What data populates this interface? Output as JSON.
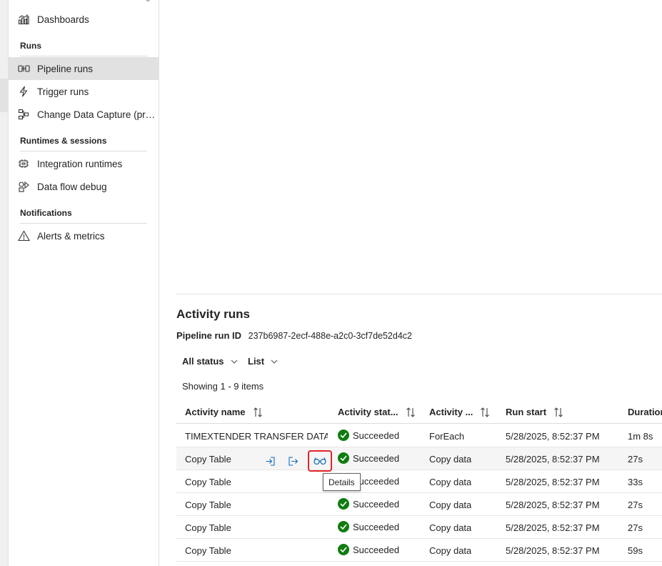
{
  "sidebar": {
    "top_item": {
      "label": "Dashboards",
      "icon": "dashboard-icon"
    },
    "sections": [
      {
        "title": "Runs"
      },
      {
        "title": "Runtimes & sessions"
      },
      {
        "title": "Notifications"
      }
    ],
    "items": [
      {
        "label": "Pipeline runs",
        "icon": "pipeline-icon",
        "selected": true
      },
      {
        "label": "Trigger runs",
        "icon": "lightning-icon"
      },
      {
        "label": "Change Data Capture (previ...",
        "icon": "cdc-icon"
      },
      {
        "label": "Integration runtimes",
        "icon": "runtime-icon"
      },
      {
        "label": "Data flow debug",
        "icon": "dataflow-debug-icon"
      },
      {
        "label": "Alerts & metrics",
        "icon": "alert-icon"
      }
    ]
  },
  "activity": {
    "title": "Activity runs",
    "pipeline_run_id_label": "Pipeline run ID",
    "pipeline_run_id": "237b6987-2ecf-488e-a2c0-3cf7de52d4c2",
    "filter_status": "All status",
    "filter_view": "List",
    "showing": "Showing 1 - 9 items",
    "columns": [
      "Activity name",
      "Activity stat...",
      "Activity ...",
      "Run start",
      "Duration"
    ],
    "rows": [
      {
        "name": "TIMEXTENDER TRANSFER DATA...",
        "status": "Succeeded",
        "type": "ForEach",
        "start": "5/28/2025, 8:52:37 PM",
        "duration": "1m 8s"
      },
      {
        "name": "Copy Table",
        "status": "Succeeded",
        "type": "Copy data",
        "start": "5/28/2025, 8:52:37 PM",
        "duration": "27s"
      },
      {
        "name": "Copy Table",
        "status": "Succeeded",
        "type": "Copy data",
        "start": "5/28/2025, 8:52:37 PM",
        "duration": "33s"
      },
      {
        "name": "Copy Table",
        "status": "Succeeded",
        "type": "Copy data",
        "start": "5/28/2025, 8:52:37 PM",
        "duration": "27s"
      },
      {
        "name": "Copy Table",
        "status": "Succeeded",
        "type": "Copy data",
        "start": "5/28/2025, 8:52:37 PM",
        "duration": "27s"
      },
      {
        "name": "Copy Table",
        "status": "Succeeded",
        "type": "Copy data",
        "start": "5/28/2025, 8:52:37 PM",
        "duration": "59s"
      }
    ],
    "tooltip": "Details",
    "colors": {
      "success": "#107c10",
      "highlight": "#e0262a",
      "accent": "#0f6cbd"
    }
  }
}
